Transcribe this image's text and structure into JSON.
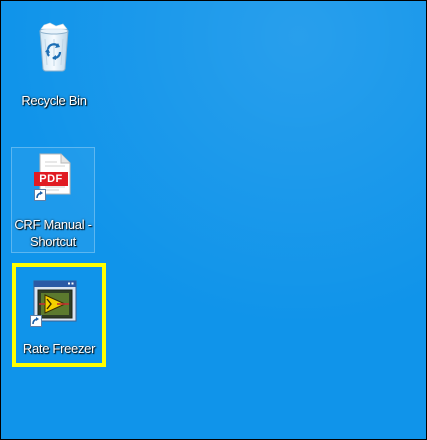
{
  "desktop": {
    "background_color": "#1094ea",
    "icons": [
      {
        "label": "Recycle Bin",
        "icon": "recycle-bin-icon"
      },
      {
        "label_line1": "CRF Manual -",
        "label_line2": "Shortcut",
        "icon": "pdf-file-icon",
        "badge": "PDF",
        "is_shortcut": true
      },
      {
        "label": "Rate Freezer",
        "icon": "rate-freezer-app-icon",
        "is_shortcut": true,
        "highlighted": true,
        "highlight_color": "#ffff00"
      }
    ]
  }
}
